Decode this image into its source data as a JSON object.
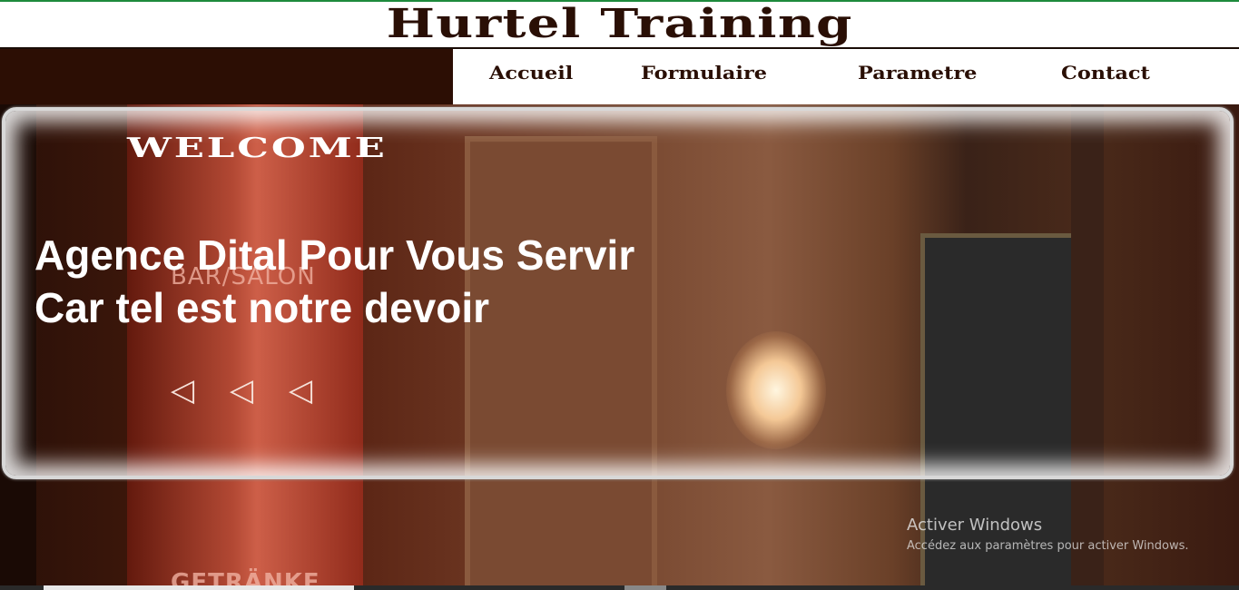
{
  "header": {
    "title": "Hurtel Training"
  },
  "nav": {
    "items": [
      {
        "label": "Accueil"
      },
      {
        "label": "Formulaire"
      },
      {
        "label": "Parametre"
      },
      {
        "label": "Contact"
      }
    ]
  },
  "hero": {
    "welcome": "WELCOME",
    "line1": "Agence Dital Pour Vous Servir",
    "line2": "Car tel est notre devoir",
    "sign_top": "BAR/SALON",
    "sign_bottom": "GETRÄNKE",
    "arrows": [
      "◁",
      "◁",
      "◁"
    ]
  },
  "watermark": {
    "title": "Activer Windows",
    "subtitle": "Accédez aux paramètres pour activer Windows."
  },
  "colors": {
    "brand": "#2a0f05",
    "accent_line": "#1d8a3c",
    "nav_block": "#2c0e04"
  }
}
